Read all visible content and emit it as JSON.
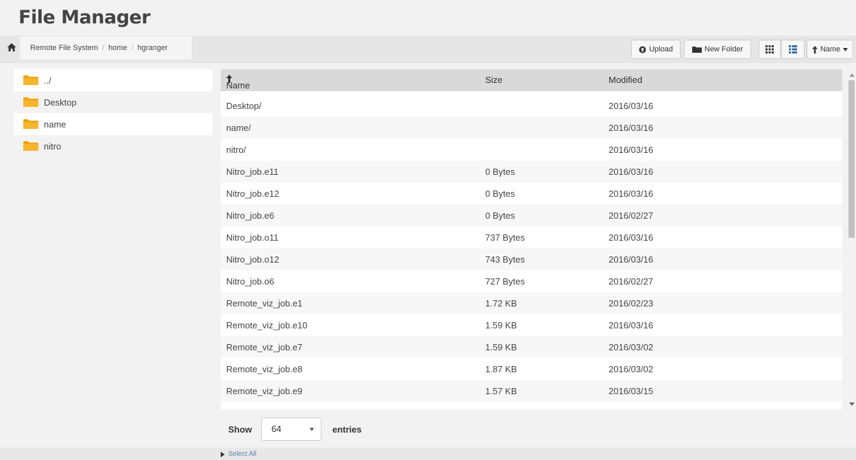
{
  "app": {
    "title": "File Manager"
  },
  "breadcrumb": [
    "Remote File System",
    "home",
    "hgranger"
  ],
  "toolbar": {
    "upload_label": "Upload",
    "new_folder_label": "New Folder",
    "sort_label": "Name",
    "icons": [
      "home-icon",
      "upload-icon",
      "folder-icon",
      "grid-view-icon",
      "list-view-icon",
      "sort-up-arrow-icon",
      "caret-down-icon"
    ]
  },
  "sidebar": {
    "items": [
      {
        "label": "../"
      },
      {
        "label": "Desktop"
      },
      {
        "label": "name"
      },
      {
        "label": "nitro"
      }
    ],
    "folder_color": "#f0a30a"
  },
  "table": {
    "columns": [
      "Name",
      "Size",
      "Modified"
    ],
    "rows": [
      {
        "name": "Desktop/",
        "size": "",
        "modified": "2016/03/16"
      },
      {
        "name": "name/",
        "size": "",
        "modified": "2016/03/16"
      },
      {
        "name": "nitro/",
        "size": "",
        "modified": "2016/03/16"
      },
      {
        "name": "Nitro_job.e11",
        "size": "0 Bytes",
        "modified": "2016/03/16"
      },
      {
        "name": "Nitro_job.e12",
        "size": "0 Bytes",
        "modified": "2016/03/16"
      },
      {
        "name": "Nitro_job.e6",
        "size": "0 Bytes",
        "modified": "2016/02/27"
      },
      {
        "name": "Nitro_job.o11",
        "size": "737 Bytes",
        "modified": "2016/03/16"
      },
      {
        "name": "Nitro_job.o12",
        "size": "743 Bytes",
        "modified": "2016/03/16"
      },
      {
        "name": "Nitro_job.o6",
        "size": "727 Bytes",
        "modified": "2016/02/27"
      },
      {
        "name": "Remote_viz_job.e1",
        "size": "1.72 KB",
        "modified": "2016/02/23"
      },
      {
        "name": "Remote_viz_job.e10",
        "size": "1.59 KB",
        "modified": "2016/03/16"
      },
      {
        "name": "Remote_viz_job.e7",
        "size": "1.59 KB",
        "modified": "2016/03/02"
      },
      {
        "name": "Remote_viz_job.e8",
        "size": "1.87 KB",
        "modified": "2016/03/02"
      },
      {
        "name": "Remote_viz_job.e9",
        "size": "1.57 KB",
        "modified": "2016/03/15"
      }
    ]
  },
  "pagination": {
    "show_label": "Show",
    "entries_value": "64",
    "entries_label": "entries"
  },
  "footer": {
    "select_all_label": "Select All"
  }
}
